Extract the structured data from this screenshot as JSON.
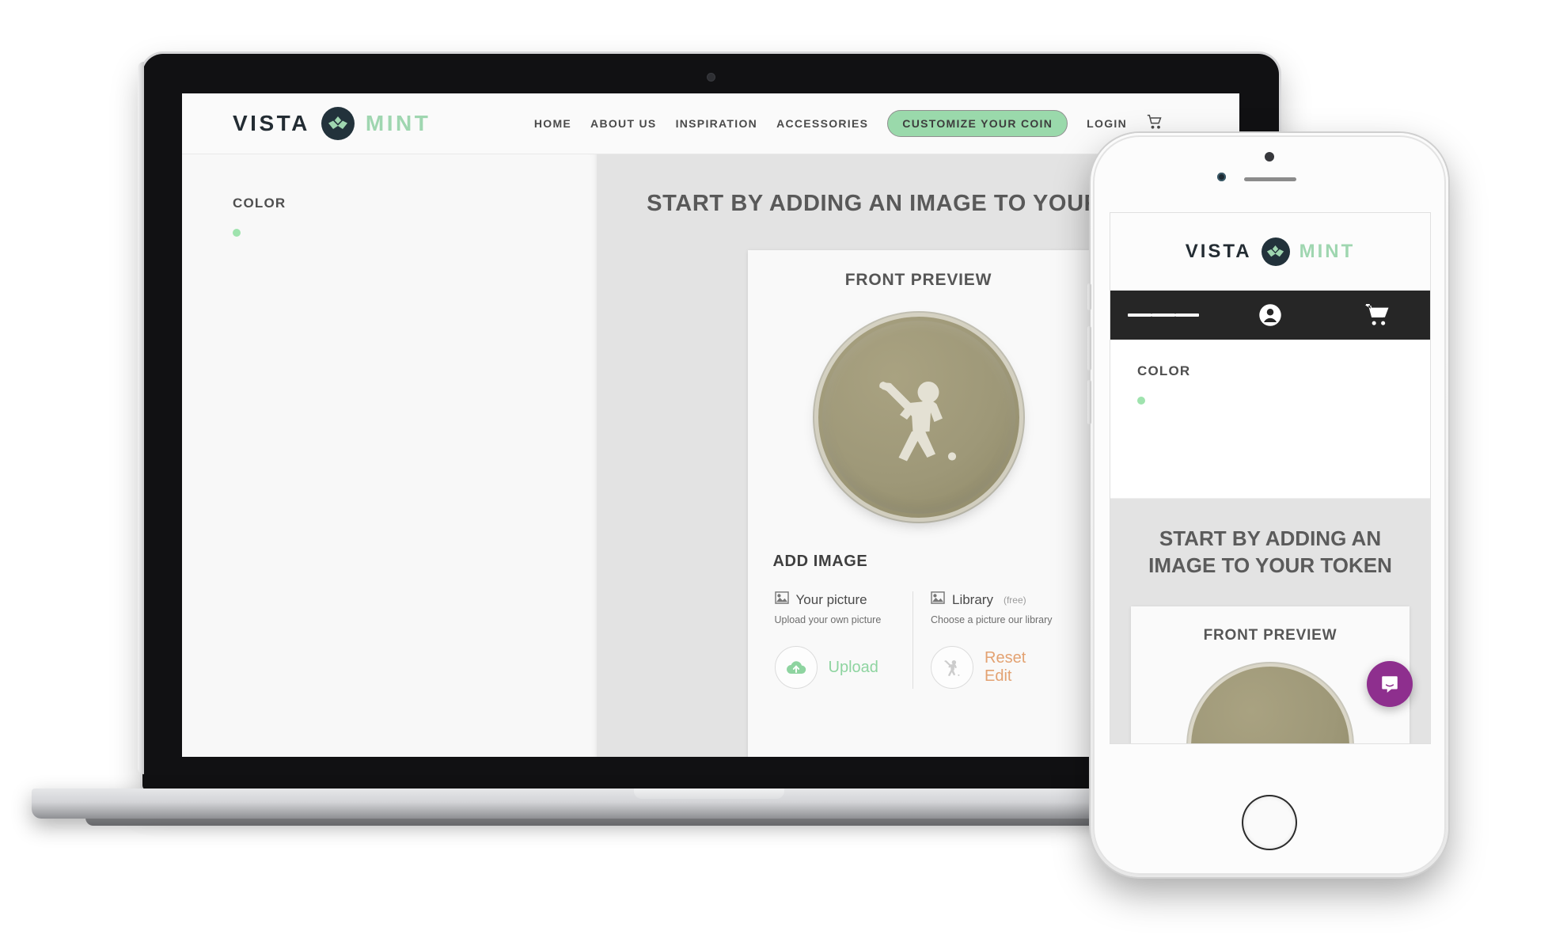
{
  "brand": {
    "name_first": "VISTA",
    "name_second": "MINT",
    "mark_icon": "mountain-logo-icon",
    "accent_green": "#9fd6b0",
    "dark": "#22323b"
  },
  "desktop": {
    "nav": {
      "items": [
        {
          "label": "HOME",
          "name": "home"
        },
        {
          "label": "ABOUT US",
          "name": "about-us"
        },
        {
          "label": "INSPIRATION",
          "name": "inspiration"
        },
        {
          "label": "ACCESSORIES",
          "name": "accessories"
        }
      ],
      "cta_label": "CUSTOMIZE YOUR COIN",
      "login_label": "LOGIN",
      "cart_icon": "cart-icon"
    },
    "sidebar": {
      "color_label": "COLOR",
      "swatches": [
        {
          "name": "antique-bronze",
          "hex": "#a49b85",
          "selected": true
        },
        {
          "name": "gold",
          "hex": "#b0902a",
          "selected": false
        }
      ]
    },
    "main": {
      "heading": "START BY ADDING AN IMAGE TO YOUR TOKEN",
      "card_title": "FRONT PREVIEW",
      "coin": {
        "face_color": "#9e9878",
        "motif": "field-hockey-player-icon",
        "motif_color": "#e3e0d3"
      },
      "add_image": {
        "section_title": "ADD IMAGE",
        "options": [
          {
            "icon": "image-icon",
            "title": "Your picture",
            "badge": "",
            "subtitle": "Upload your own picture",
            "action_icon": "cloud-upload-icon",
            "action_label": "Upload",
            "action_color": "#8ed4a0"
          },
          {
            "icon": "image-icon",
            "title": "Library",
            "badge": "(free)",
            "subtitle": "Choose a picture our library",
            "action_icon": "field-hockey-player-icon",
            "action_label": "Reset\nEdit",
            "action_color": "#e3a272"
          }
        ]
      }
    }
  },
  "mobile": {
    "nav": {
      "menu_icon": "hamburger-menu-icon",
      "account_icon": "account-circle-icon",
      "cart_icon": "shopping-cart-icon"
    },
    "sidebar": {
      "color_label": "COLOR"
    },
    "main": {
      "heading": "START BY ADDING AN IMAGE TO YOUR TOKEN",
      "card_title": "FRONT PREVIEW"
    },
    "chat": {
      "icon": "chat-bubble-icon",
      "color": "#8e2f8e"
    }
  }
}
